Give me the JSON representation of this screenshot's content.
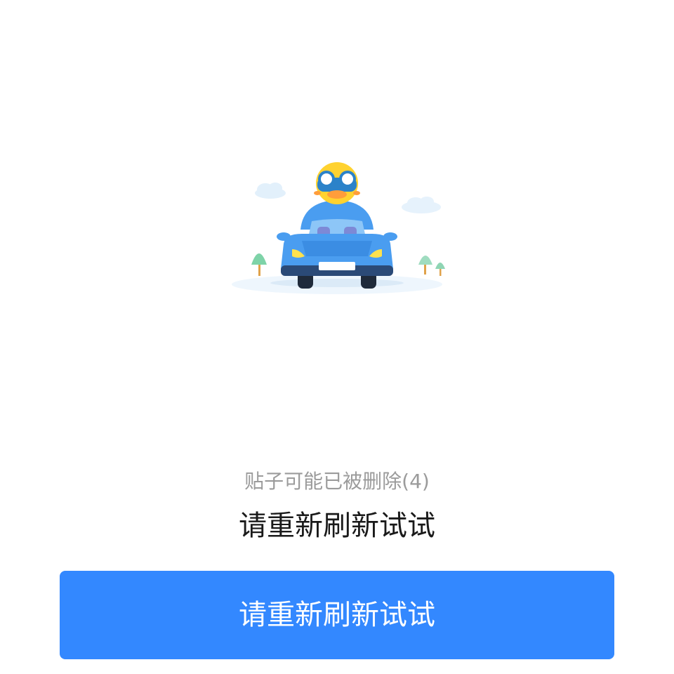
{
  "illustration": {
    "icon": "car-mascot-illustration",
    "colors": {
      "car_body": "#4a9df0",
      "mascot_face": "#ffd230",
      "lights": "#ffe14d",
      "ground": "#eaf4fc"
    }
  },
  "message": {
    "error": "贴子可能已被删除(4)",
    "hint": "请重新刷新试试"
  },
  "button": {
    "label": "请重新刷新试试",
    "color": "#3388ff"
  }
}
